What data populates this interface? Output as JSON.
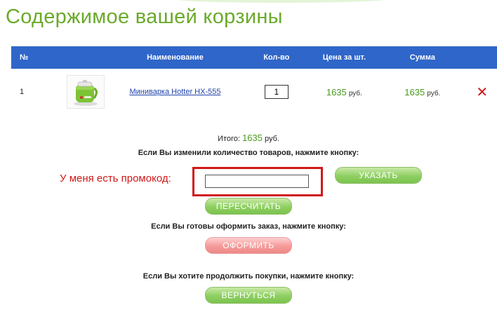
{
  "page": {
    "title": "Содержимое вашей корзины"
  },
  "cart_table": {
    "headers": {
      "num": "№",
      "name": "Наименование",
      "qty": "Кол-во",
      "price": "Цена за шт.",
      "sum": "Сумма"
    },
    "rows": [
      {
        "num": "1",
        "name": "Мини­варка Hotter HX-555",
        "qty": "1",
        "price": "1635",
        "price_unit": "руб.",
        "sum": "1635",
        "sum_unit": "руб.",
        "delete_icon": "close-x-icon"
      }
    ]
  },
  "total": {
    "label": "Итого:",
    "value": "1635",
    "unit": "руб."
  },
  "notes": {
    "change_qty": "Если Вы изменили количество товаров, нажмите кнопку:",
    "ready_order": "Если Вы готовы оформить заказ, нажмите кнопку:",
    "continue": "Если Вы хотите продолжить покупки, нажмите кнопку:"
  },
  "promo": {
    "label": "У меня есть промокод:",
    "value": ""
  },
  "buttons": {
    "apply": "УКАЗАТЬ",
    "recalc": "ПЕРЕСЧИТАТЬ",
    "checkout": "ОФОРМИТЬ",
    "back": "ВЕРНУТЬСЯ"
  },
  "colors": {
    "title_green": "#6aaa2a",
    "header_blue": "#2f66c9",
    "price_green": "#4a9a1c",
    "promo_red": "#d01818",
    "button_green": "#8ecf62",
    "button_pink": "#f59a9a"
  }
}
